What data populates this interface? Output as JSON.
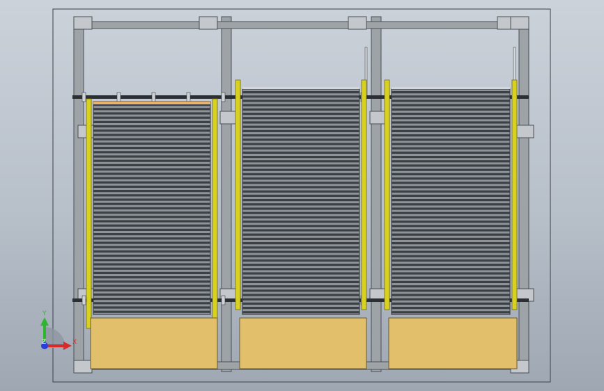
{
  "viewport": {
    "background_top": "#cbd2da",
    "background_bottom": "#9ea7b2",
    "frame_outline": "#3a3f45"
  },
  "model": {
    "frame_color": "#9ea3a8",
    "frame_edge": "#4a4f55",
    "rail_color": "#2b2f33",
    "guide_color": "#d9d11f",
    "roller_dark": "#3c4044",
    "roller_light": "#8c9399",
    "platform_color": "#e2bf6b",
    "platform_edge": "#6b5a2e",
    "highlight_strip": "#e9b36d",
    "conveyor_count": 3
  },
  "triad": {
    "y_label": "Y",
    "x_label": "X",
    "z_label": "Z",
    "y_color": "#2fb52f",
    "x_color": "#d82a2a",
    "z_color": "#2a3fd8"
  }
}
